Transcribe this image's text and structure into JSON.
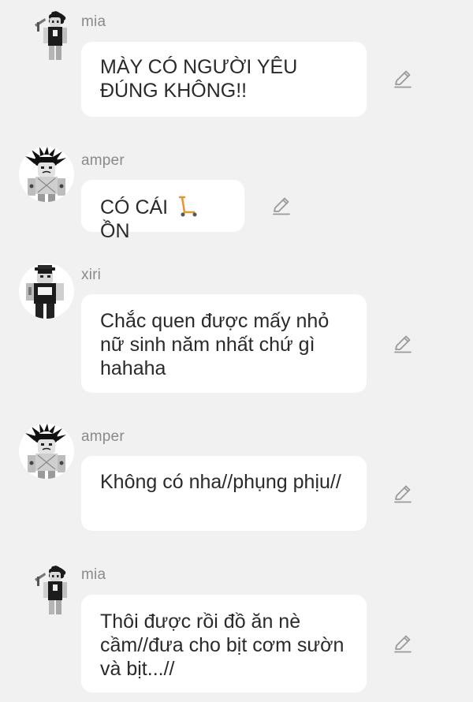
{
  "messages": [
    {
      "user": "mia",
      "text": "MÀY CÓ NGƯỜI YÊU ĐÚNG KHÔNG!!"
    },
    {
      "user": "amper",
      "text_before": "CÓ CÁI",
      "emoji": "scooter-icon",
      "text_after": "ỒN"
    },
    {
      "user": "xiri",
      "text": "Chắc quen được mấy nhỏ nữ sinh năm nhất chứ gì hahaha"
    },
    {
      "user": "amper",
      "text": "Không có nha//phụng phịu//"
    },
    {
      "user": "mia",
      "text": "Thôi được rồi đồ ăn nè cầm//đưa cho bịt cơm sườn và bịt...//"
    }
  ],
  "colors": {
    "background": "#f1f1f1",
    "bubble": "#ffffff",
    "username": "#8a8a8a",
    "text": "#2a2a2a",
    "icon": "#9a9a9a",
    "scooter": "#e8962e"
  }
}
